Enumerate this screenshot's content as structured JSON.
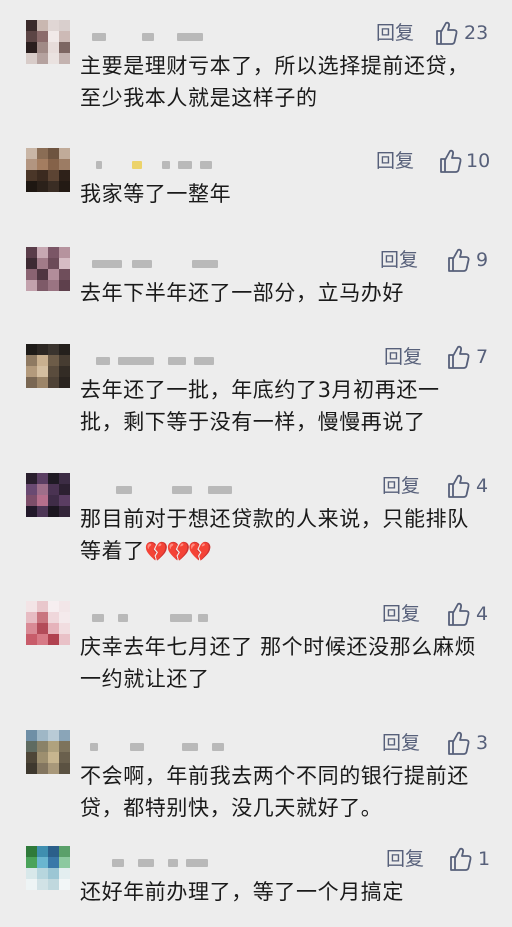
{
  "reply_label": "回复",
  "comments": [
    {
      "likes": "23",
      "text": "主要是理财亏本了，所以选择提前还贷，至少我本人就是这样子的",
      "emoji": ""
    },
    {
      "likes": "10",
      "text": "我家等了一整年",
      "emoji": ""
    },
    {
      "likes": "9",
      "text": "去年下半年还了一部分，立马办好",
      "emoji": ""
    },
    {
      "likes": "7",
      "text": "去年还了一批，年底约了3月初再还一批，剩下等于没有一样，慢慢再说了",
      "emoji": ""
    },
    {
      "likes": "4",
      "text": "那目前对于想还贷款的人来说，只能排队等着了",
      "emoji": "💔💔💔"
    },
    {
      "likes": "4",
      "text": "庆幸去年七月还了 那个时候还没那么麻烦 一约就让还了",
      "emoji": ""
    },
    {
      "likes": "3",
      "text": "不会啊，年前我去两个不同的银行提前还贷，都特别快，没几天就好了。",
      "emoji": ""
    },
    {
      "likes": "1",
      "text": "还好年前办理了，等了一个月搞定",
      "emoji": ""
    }
  ]
}
